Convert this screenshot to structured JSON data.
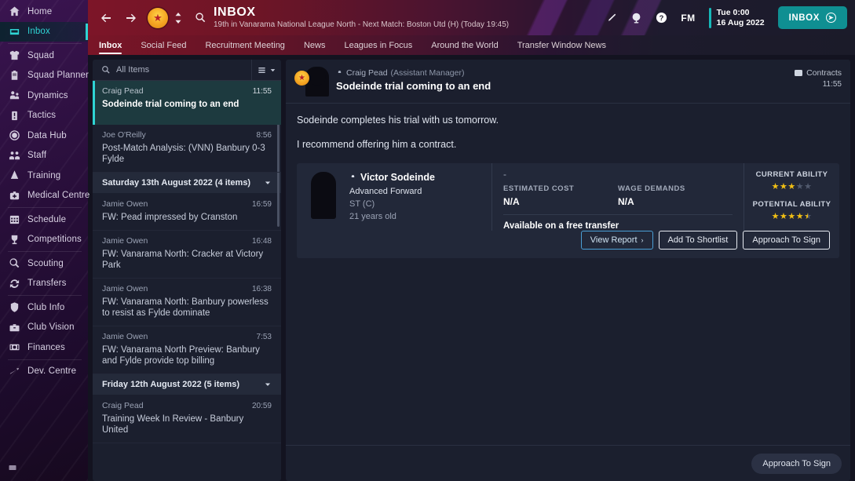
{
  "sidebar": {
    "items": [
      {
        "label": "Home",
        "icon": "home-icon",
        "active": false,
        "sep": false
      },
      {
        "label": "Inbox",
        "icon": "inbox-icon",
        "active": true,
        "sep": false
      },
      {
        "label": "Squad",
        "icon": "shirt-icon",
        "active": false,
        "sep": true
      },
      {
        "label": "Squad Planner",
        "icon": "clipboard-icon",
        "active": false,
        "sep": false
      },
      {
        "label": "Dynamics",
        "icon": "people-icon",
        "active": false,
        "sep": false
      },
      {
        "label": "Tactics",
        "icon": "tactics-icon",
        "active": false,
        "sep": false
      },
      {
        "label": "Data Hub",
        "icon": "circle-icon",
        "active": false,
        "sep": false
      },
      {
        "label": "Staff",
        "icon": "staff-icon",
        "active": false,
        "sep": false
      },
      {
        "label": "Training",
        "icon": "training-icon",
        "active": false,
        "sep": false
      },
      {
        "label": "Medical Centre",
        "icon": "medical-cross-icon",
        "active": false,
        "sep": false
      },
      {
        "label": "Schedule",
        "icon": "calendar-icon",
        "active": false,
        "sep": true
      },
      {
        "label": "Competitions",
        "icon": "trophy-icon",
        "active": false,
        "sep": false
      },
      {
        "label": "Scouting",
        "icon": "magnifier-icon",
        "active": false,
        "sep": true
      },
      {
        "label": "Transfers",
        "icon": "transfer-icon",
        "active": false,
        "sep": false
      },
      {
        "label": "Club Info",
        "icon": "shield-icon",
        "active": false,
        "sep": true
      },
      {
        "label": "Club Vision",
        "icon": "briefcase-icon",
        "active": false,
        "sep": false
      },
      {
        "label": "Finances",
        "icon": "money-icon",
        "active": false,
        "sep": false
      },
      {
        "label": "Dev. Centre",
        "icon": "growth-arrow-icon",
        "active": false,
        "sep": true
      }
    ]
  },
  "header": {
    "title": "INBOX",
    "subtitle": "19th in Vanarama National League North - Next Match: Boston Utd (H) (Today 19:45)",
    "fm_logo": "FM",
    "date_time": "Tue 0:00",
    "date_day": "16 Aug 2022",
    "inbox_button": "INBOX",
    "accent_teal": "#0f8f92",
    "accent_red": "#7d1528"
  },
  "tabs": [
    {
      "label": "Inbox",
      "active": true
    },
    {
      "label": "Social Feed",
      "active": false
    },
    {
      "label": "Recruitment Meeting",
      "active": false
    },
    {
      "label": "News",
      "active": false
    },
    {
      "label": "Leagues in Focus",
      "active": false
    },
    {
      "label": "Around the World",
      "active": false
    },
    {
      "label": "Transfer Window News",
      "active": false
    }
  ],
  "list": {
    "filter_label": "All Items",
    "messages": [
      {
        "type": "msg",
        "sender": "Craig Pead",
        "time": "11:55",
        "subject": "Sodeinde trial coming to an end",
        "selected": true
      },
      {
        "type": "msg",
        "sender": "Joe O'Reilly",
        "time": "8:56",
        "subject": "Post-Match Analysis: (VNN) Banbury 0-3 Fylde",
        "selected": false
      },
      {
        "type": "group",
        "label": "Saturday 13th August 2022 (4 items)"
      },
      {
        "type": "msg",
        "sender": "Jamie Owen",
        "time": "16:59",
        "subject": "FW: Pead impressed by Cranston",
        "selected": false
      },
      {
        "type": "msg",
        "sender": "Jamie Owen",
        "time": "16:48",
        "subject": "FW: Vanarama North: Cracker at Victory Park",
        "selected": false
      },
      {
        "type": "msg",
        "sender": "Jamie Owen",
        "time": "16:38",
        "subject": "FW: Vanarama North: Banbury powerless to resist as Fylde dominate",
        "selected": false
      },
      {
        "type": "msg",
        "sender": "Jamie Owen",
        "time": "7:53",
        "subject": "FW: Vanarama North Preview: Banbury and Fylde provide top billing",
        "selected": false
      },
      {
        "type": "group",
        "label": "Friday 12th August 2022 (5 items)"
      },
      {
        "type": "msg",
        "sender": "Craig Pead",
        "time": "20:59",
        "subject": "Training Week In Review - Banbury United",
        "selected": false
      }
    ]
  },
  "detail": {
    "sender": "Craig Pead",
    "sender_role": "(Assistant Manager)",
    "subject": "Sodeinde trial coming to an end",
    "category": "Contracts",
    "time": "11:55",
    "paragraph_1": "Sodeinde completes his trial with us tomorrow.",
    "paragraph_2": "I recommend offering him a contract.",
    "player": {
      "name": "Victor Sodeinde",
      "role": "Advanced Forward",
      "position": "ST (C)",
      "age": "21 years old",
      "dash": "-",
      "estimated_cost_label": "ESTIMATED COST",
      "estimated_cost": "N/A",
      "wage_demands_label": "WAGE DEMANDS",
      "wage_demands": "N/A",
      "transfer_status": "Available on a free transfer",
      "current_ability_label": "CURRENT ABILITY",
      "current_ability_stars": 3,
      "potential_ability_label": "POTENTIAL ABILITY",
      "potential_ability_stars": 4.5,
      "star_max": 5,
      "buttons": [
        {
          "label": "View Report",
          "style": "blue",
          "chevron": "›"
        },
        {
          "label": "Add To Shortlist",
          "style": "white",
          "chevron": ""
        },
        {
          "label": "Approach To Sign",
          "style": "white",
          "chevron": ""
        }
      ]
    }
  },
  "footer": {
    "action_button": "Approach To Sign"
  }
}
